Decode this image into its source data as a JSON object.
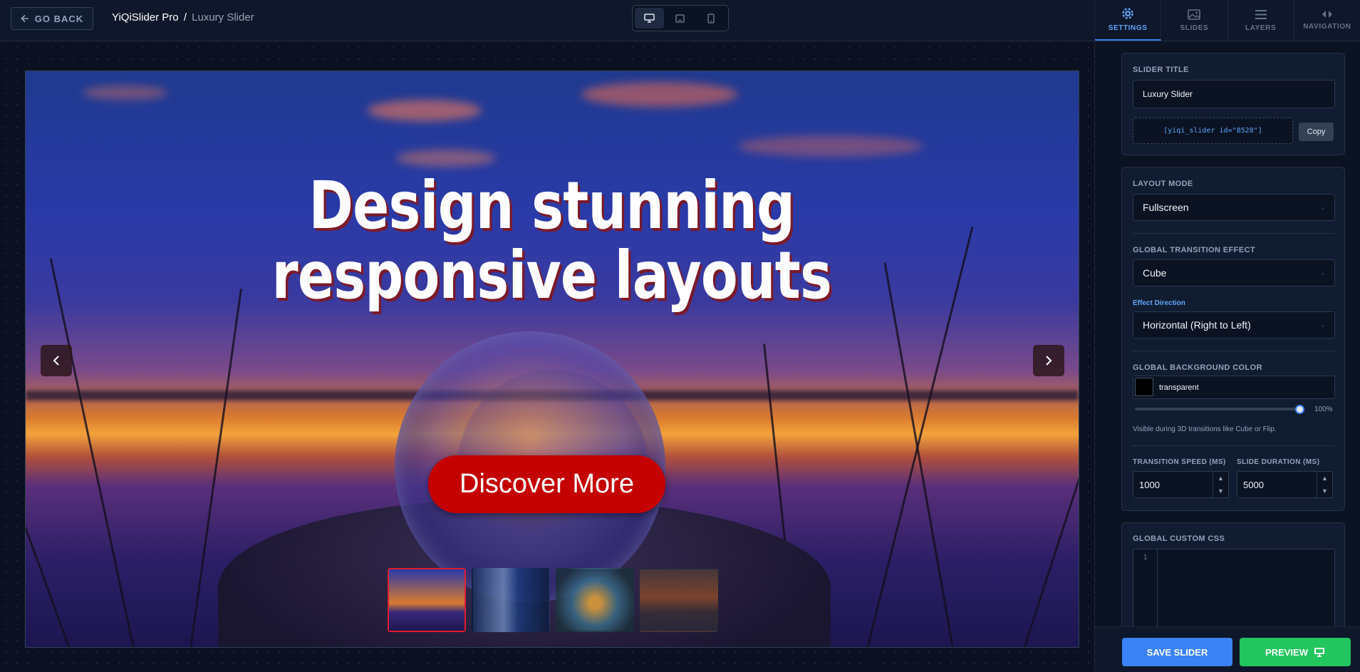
{
  "topbar": {
    "back_label": "GO BACK",
    "app_name": "YiQiSlider Pro",
    "separator": "/",
    "current_slider": "Luxury Slider",
    "devices": [
      "desktop-icon",
      "tablet-icon",
      "mobile-icon"
    ],
    "active_device": "desktop"
  },
  "slide": {
    "headline_line1": "Design stunning",
    "headline_line2": "responsive layouts",
    "button_label": "Discover More",
    "prev_arrow": "‹",
    "next_arrow": "›",
    "thumbnail_count": 4,
    "active_thumbnail": 1
  },
  "panel": {
    "tabs": [
      {
        "label": "SETTINGS",
        "icon": "gear-icon",
        "active": true
      },
      {
        "label": "SLIDES",
        "icon": "image-icon",
        "active": false
      },
      {
        "label": "LAYERS",
        "icon": "layers-icon",
        "active": false
      },
      {
        "label": "NAVIGATION",
        "icon": "navigation-arrows-icon",
        "active": false
      }
    ],
    "slider_title": {
      "label": "SLIDER TITLE",
      "value": "Luxury Slider",
      "shortcode": "[yiqi_slider id=\"8528\"]",
      "copy_label": "Copy"
    },
    "layout_mode": {
      "label": "LAYOUT MODE",
      "value": "Fullscreen"
    },
    "transition_effect": {
      "label": "GLOBAL TRANSITION EFFECT",
      "value": "Cube"
    },
    "effect_direction": {
      "label": "Effect Direction",
      "value": "Horizontal (Right to Left)"
    },
    "background_color": {
      "label": "GLOBAL BACKGROUND COLOR",
      "value": "transparent",
      "swatch_color": "#000000",
      "opacity": "100%",
      "opacity_fraction": 1.0,
      "hint": "Visible during 3D transitions like Cube or Flip."
    },
    "transition_speed": {
      "label": "TRANSITION SPEED (MS)",
      "value": "1000"
    },
    "slide_duration": {
      "label": "SLIDE DURATION (MS)",
      "value": "5000"
    },
    "custom_css": {
      "label": "GLOBAL CUSTOM CSS",
      "line_number": "1"
    },
    "save_label": "SAVE SLIDER",
    "preview_label": "PREVIEW"
  },
  "colors": {
    "accent": "#3b82f6",
    "save": "#3b82f6",
    "preview": "#22c55e",
    "cta": "#c40000",
    "active_thumb_border": "#e11d2e"
  }
}
